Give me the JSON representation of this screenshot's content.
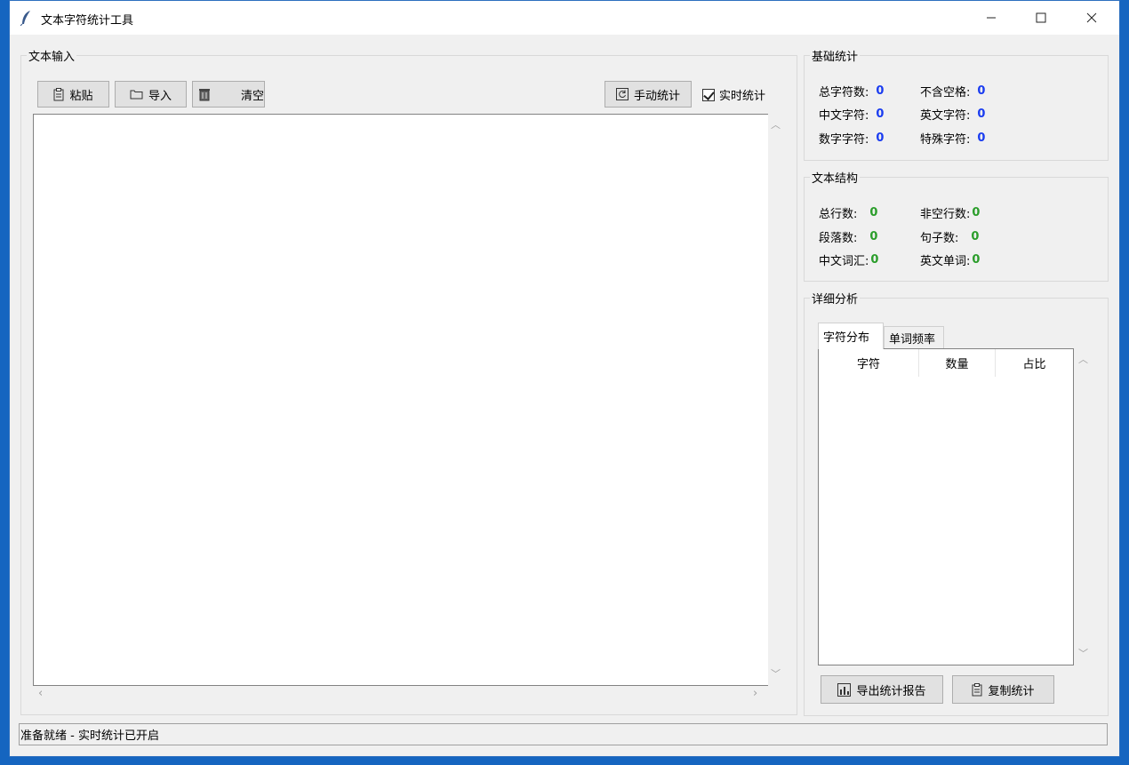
{
  "window": {
    "title": "文本字符统计工具",
    "min_icon": "minimize-icon",
    "max_icon": "maximize-icon",
    "close_icon": "close-icon"
  },
  "input": {
    "section_label": "文本输入",
    "paste_label": "粘贴",
    "import_label": "导入",
    "clear_label": "清空",
    "manual_label": "手动统计",
    "realtime_label": "实时统计",
    "realtime_checked": true
  },
  "basic": {
    "section_label": "基础统计",
    "total_chars": {
      "label": "总字符数:",
      "value": "0"
    },
    "no_space": {
      "label": "不含空格:",
      "value": "0"
    },
    "chinese": {
      "label": "中文字符:",
      "value": "0"
    },
    "english": {
      "label": "英文字符:",
      "value": "0"
    },
    "digits": {
      "label": "数字字符:",
      "value": "0"
    },
    "special": {
      "label": "特殊字符:",
      "value": "0"
    }
  },
  "structure": {
    "section_label": "文本结构",
    "lines": {
      "label": "总行数:",
      "value": "0"
    },
    "nonempty": {
      "label": "非空行数:",
      "value": "0"
    },
    "paragraphs": {
      "label": "段落数:",
      "value": "0"
    },
    "sentences": {
      "label": "句子数:",
      "value": "0"
    },
    "cn_words": {
      "label": "中文词汇:",
      "value": "0"
    },
    "en_words": {
      "label": "英文单词:",
      "value": "0"
    }
  },
  "detail": {
    "section_label": "详细分析",
    "tabs": [
      "字符分布",
      "单词频率"
    ],
    "columns": [
      "字符",
      "数量",
      "占比"
    ],
    "export_label": "导出统计报告",
    "copy_label": "复制统计"
  },
  "status": "准备就绪 - 实时统计已开启",
  "colors": {
    "basic_value": "#1a3cf0",
    "struct_value": "#2a9d2a"
  }
}
